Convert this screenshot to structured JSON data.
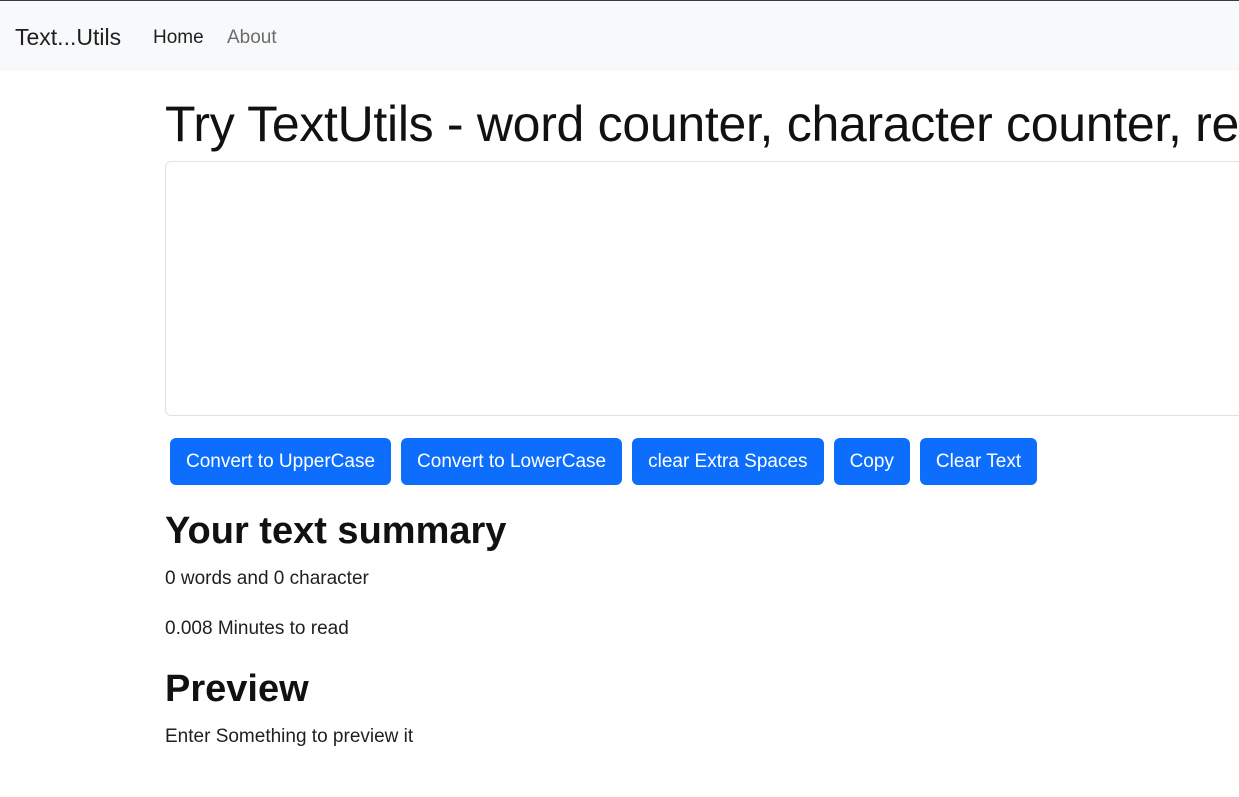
{
  "navbar": {
    "brand": "Text...Utils",
    "links": [
      {
        "label": "Home"
      },
      {
        "label": "About"
      }
    ]
  },
  "main": {
    "heading": "Try TextUtils - word counter, character counter, remove extra spaces",
    "textarea": {
      "value": "",
      "placeholder": ""
    },
    "buttons": [
      {
        "label": "Convert to UpperCase"
      },
      {
        "label": "Convert to LowerCase"
      },
      {
        "label": "clear Extra Spaces"
      },
      {
        "label": "Copy"
      },
      {
        "label": "Clear Text"
      }
    ],
    "summary": {
      "title": "Your text summary",
      "word_count_text": "0 words and 0 character",
      "read_time_text": "0.008 Minutes to read"
    },
    "preview": {
      "title": "Preview",
      "text": "Enter Something to preview it"
    }
  },
  "colors": {
    "navbar_bg": "#f8f9fa",
    "button_primary": "#0d6efd",
    "nav_muted": "#6c6c6c"
  }
}
